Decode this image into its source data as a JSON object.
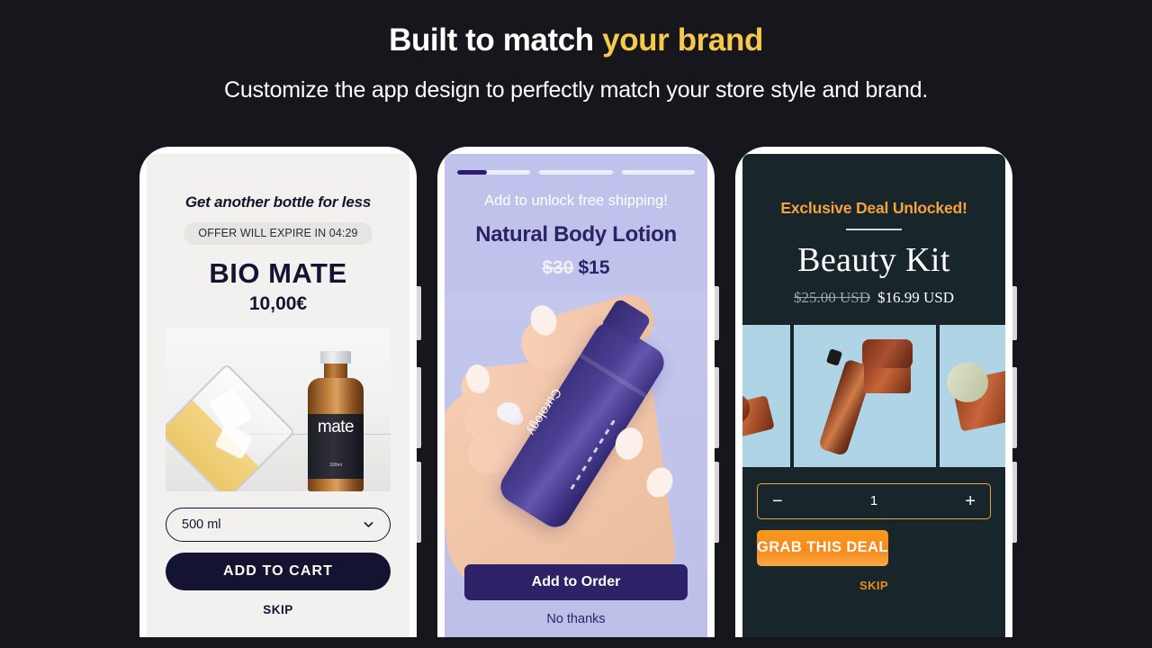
{
  "header": {
    "headline_main": "Built to match ",
    "headline_accent": "your brand",
    "subheadline": "Customize the app design to perfectly match your store style and brand.",
    "accent_color": "#f6c84c",
    "background_color": "#16161c"
  },
  "phones": [
    {
      "theme_name": "light-minimal",
      "kicker": "Get another bottle for less",
      "timer_badge": "OFFER WILL EXPIRE IN 04:29",
      "product_title": "BIO MATE",
      "price": "10,00€",
      "product_image_alt": "mate",
      "variant_selected": "500 ml",
      "variant_chevron": "chevron-down-icon",
      "cta_label": "ADD TO CART",
      "skip_label": "SKIP",
      "accent_color": "#141432",
      "background_color": "#f2f1ef"
    },
    {
      "theme_name": "periwinkle",
      "progress_total": 3,
      "progress_current_fill_percent": 40,
      "kicker": "Add to unlock free shipping!",
      "product_title": "Natural Body Lotion",
      "price_old": "$30",
      "price_new": "$15",
      "product_image_alt": "Curology",
      "cta_label": "Add to Order",
      "skip_label": "No thanks",
      "accent_color": "#2d2268",
      "background_color": "#bfc2ea"
    },
    {
      "theme_name": "dark-teal",
      "kicker": "Exclusive Deal Unlocked!",
      "product_title": "Beauty Kit",
      "price_old": "$25.00 USD",
      "price_new": "$16.99 USD",
      "gallery_count": 3,
      "qty_decrement": "−",
      "qty_value": "1",
      "qty_increment": "+",
      "cta_label": "GRAB THIS DEAL",
      "skip_label": "SKIP",
      "accent_color": "#f2a33f",
      "background_color": "#18262b"
    }
  ]
}
